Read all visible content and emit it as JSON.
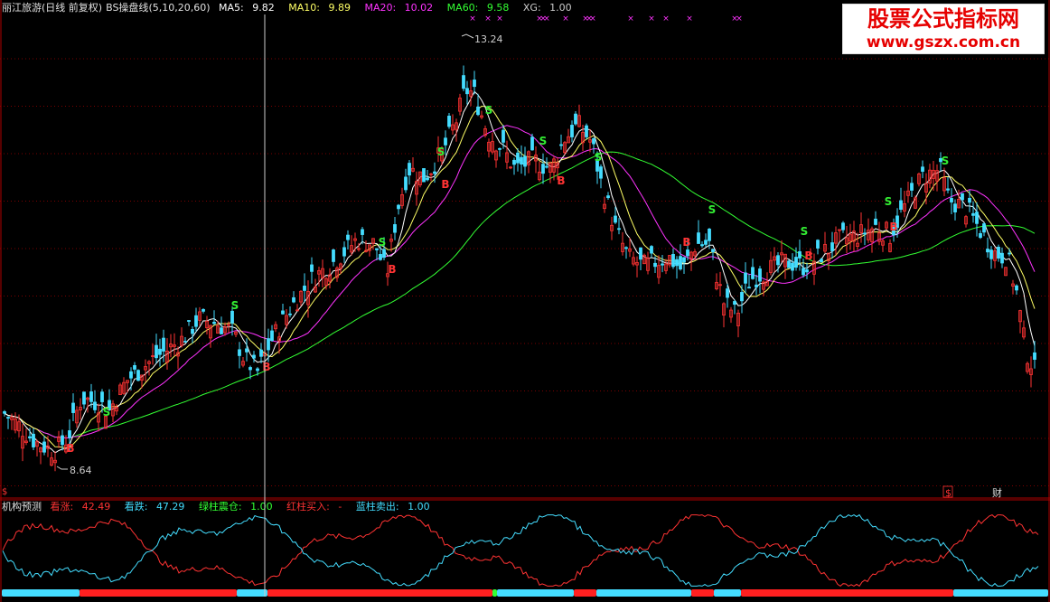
{
  "main_panel": {
    "stock_name": "丽江旅游",
    "period_info": "(日线 前复权)",
    "indicator_name": "BS操盘线",
    "indicator_params": "(5,10,20,60)",
    "ma5": {
      "label": "MA5:",
      "value": "9.82",
      "color": "#ffffff"
    },
    "ma10": {
      "label": "MA10:",
      "value": "9.89",
      "color": "#ffff66"
    },
    "ma20": {
      "label": "MA20:",
      "value": "10.02",
      "color": "#ff33ff"
    },
    "ma60": {
      "label": "MA60:",
      "value": "9.58",
      "color": "#33ff33"
    },
    "xg": {
      "label": "XG:",
      "value": "1.00"
    },
    "high_marker": "13.24",
    "low_marker": "8.64",
    "buy_signal_label": "B",
    "sell_signal_label": "S",
    "bottom_left_marker": "$",
    "bottom_right_marker": "$",
    "finance_label": "财"
  },
  "sub_panel": {
    "name": "机构预测",
    "rise": {
      "label": "看涨:",
      "value": "42.49",
      "color": "#ff3333"
    },
    "fall": {
      "label": "看跌:",
      "value": "47.29",
      "color": "#44ddff"
    },
    "green_bar": {
      "label": "绿柱震仓:",
      "value": "1.00",
      "color": "#33ff33"
    },
    "red_bar": {
      "label": "红柱买入:",
      "value": "-",
      "color": "#ff3333"
    },
    "blue_bar": {
      "label": "蓝柱卖出:",
      "value": "1.00",
      "color": "#44ddff"
    }
  },
  "watermark": {
    "title": "股票公式指标网",
    "url": "www.gszx.com.cn"
  },
  "colors": {
    "up": "#ff3333",
    "down": "#44ddff",
    "grid": "#7a0000",
    "border": "#b00000",
    "crosshair": "#cccccc"
  }
}
